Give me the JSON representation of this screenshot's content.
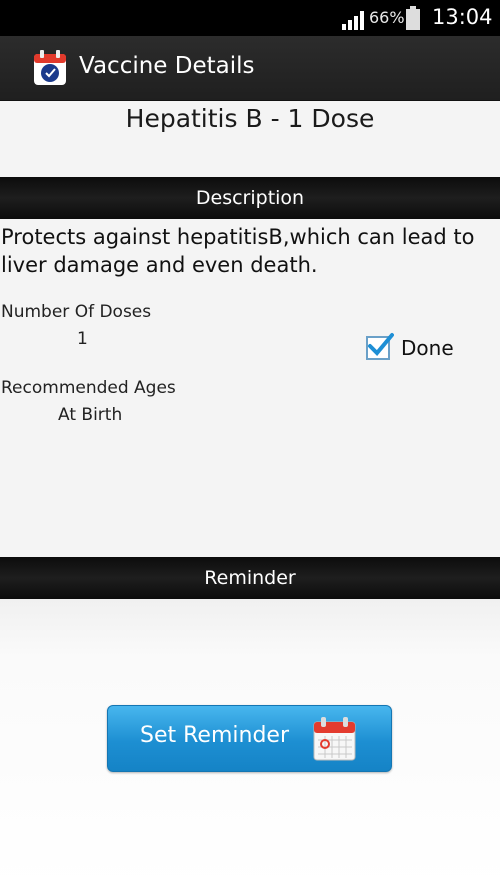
{
  "status_bar": {
    "battery_percent": "66%",
    "time": "13:04"
  },
  "action_bar": {
    "title": "Vaccine Details",
    "icon": "app-calendar-icon"
  },
  "vaccine": {
    "title": "Hepatitis B - 1 Dose",
    "description_header": "Description",
    "description": "Protects against hepatitisB,which can lead to liver damage and even death.",
    "doses_label": "Number Of Doses",
    "doses_value": "1",
    "ages_label": "Recommended Ages",
    "ages_value": "At Birth",
    "done_label": "Done",
    "done_checked": true
  },
  "reminder": {
    "header": "Reminder",
    "button_label": "Set Reminder",
    "button_icon": "calendar-icon"
  },
  "colors": {
    "accent": "#1d8fd2",
    "header_bg": "#111111"
  }
}
